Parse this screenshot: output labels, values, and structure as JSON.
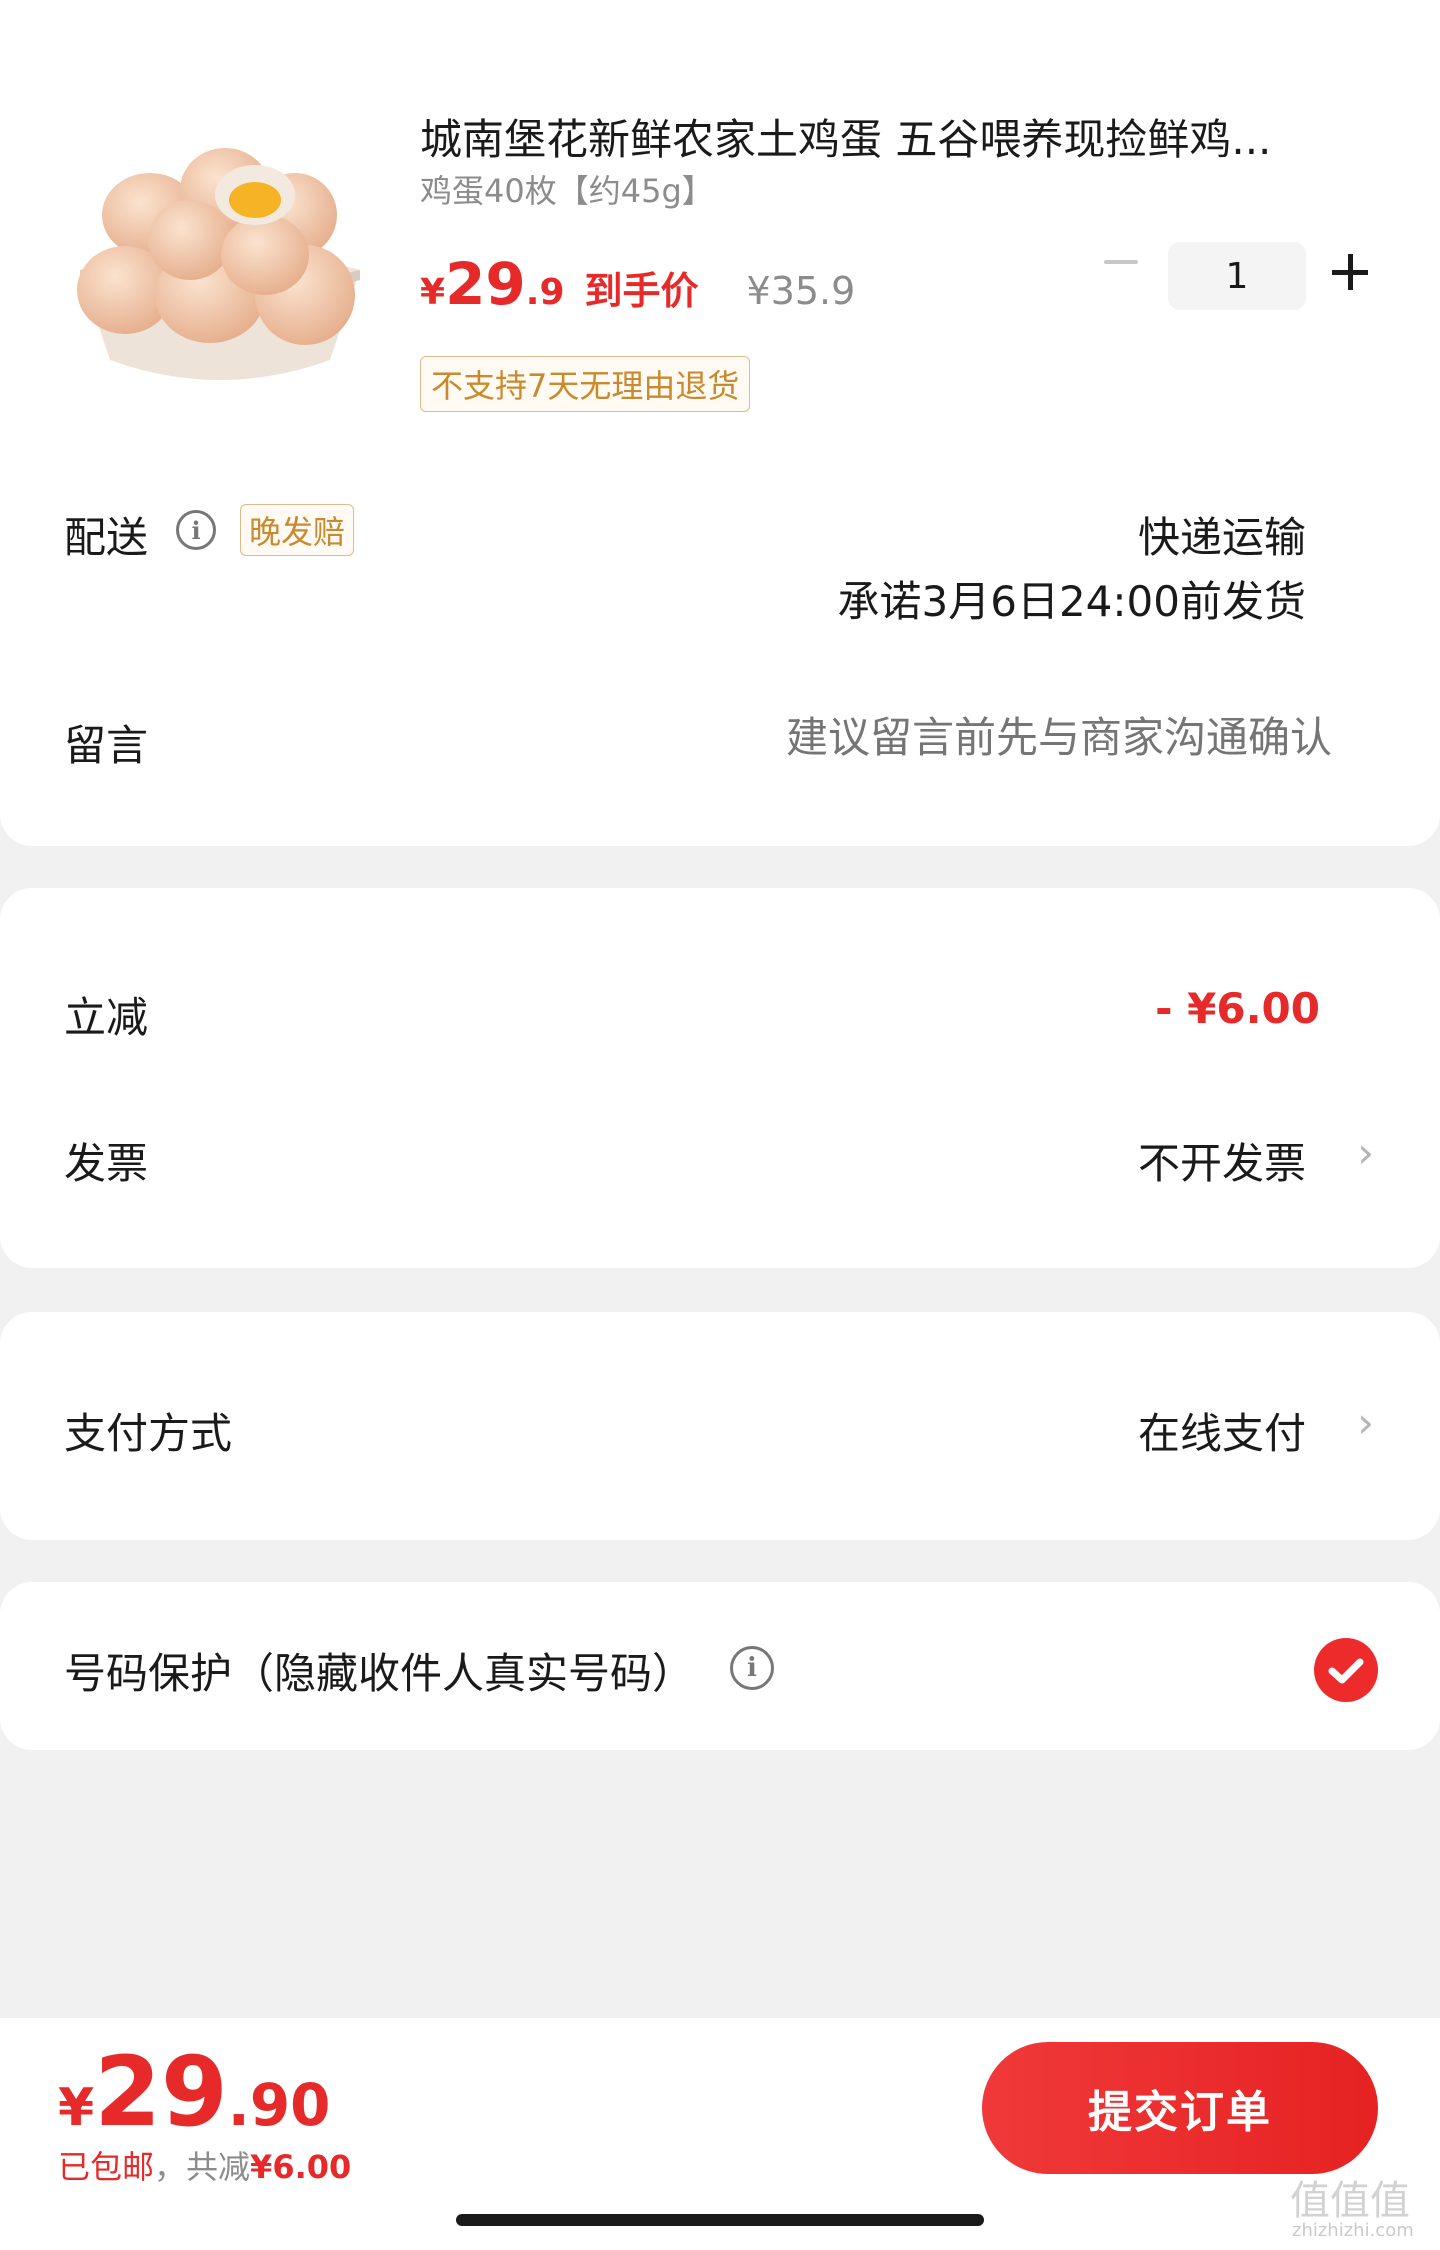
{
  "product": {
    "title": "城南堡花新鲜农家土鸡蛋 五谷喂养现捡鲜鸡...",
    "spec": "鸡蛋40枚【约45g】",
    "currency": "¥",
    "price_int": "29",
    "price_dec": ".9",
    "price_note": "到手价",
    "original_price": "¥35.9",
    "quantity": "1",
    "return_tag": "不支持7天无理由退货"
  },
  "delivery": {
    "label": "配送",
    "badge": "晚发赔",
    "method": "快递运输",
    "promise": "承诺3月6日24:00前发货"
  },
  "message": {
    "label": "留言",
    "placeholder": "建议留言前先与商家沟通确认"
  },
  "discount": {
    "label": "立减",
    "value": "- ¥6.00"
  },
  "invoice": {
    "label": "发票",
    "value": "不开发票"
  },
  "payment": {
    "label": "支付方式",
    "value": "在线支付"
  },
  "privacy": {
    "label": "号码保护（隐藏收件人真实号码）",
    "checked": true
  },
  "footer": {
    "currency": "¥",
    "total_int": "29",
    "total_dec": ".90",
    "shipping_note": "已包邮",
    "separator": "，",
    "saving_prefix": "共减",
    "saving_amount": "¥6.00",
    "submit_label": "提交订单"
  },
  "watermark": {
    "brand": "值值值",
    "domain": "zhizhizhi.com"
  },
  "colors": {
    "accent_red": "#e62a2a",
    "tag_orange": "#c98a2d",
    "muted_gray": "#8c8c8c",
    "button_red": "#ee2b2b"
  },
  "icons": [
    "info-icon",
    "minus-icon",
    "plus-icon",
    "chevron-right-icon",
    "checkmark-icon"
  ]
}
